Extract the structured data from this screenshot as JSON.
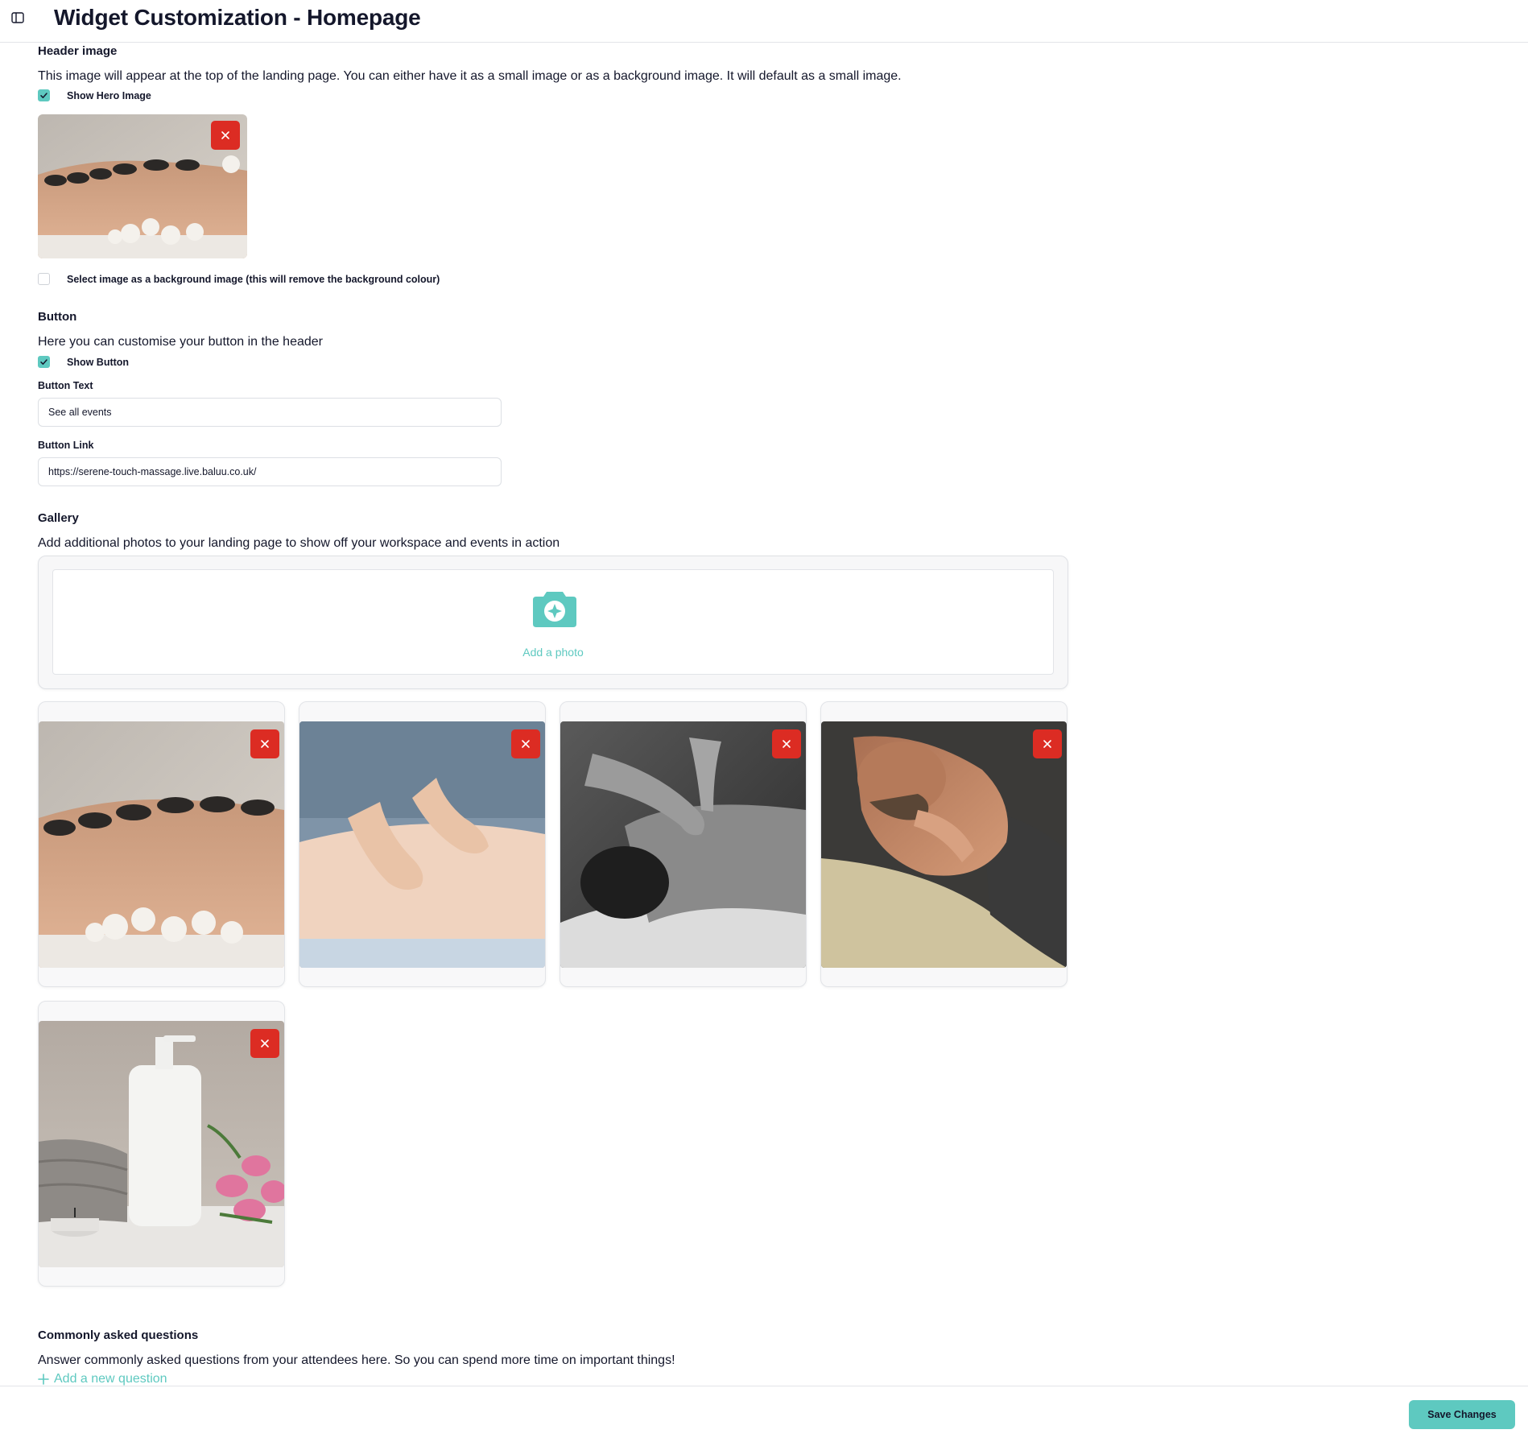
{
  "header": {
    "title": "Widget Customization - Homepage"
  },
  "header_image": {
    "title": "Header image",
    "description": "This image will appear at the top of the landing page. You can either have it as a small image or as a background image. It will default as a small image.",
    "show_hero_label": "Show Hero Image",
    "show_hero_checked": true,
    "background_option_label": "Select image as a background image (this will remove the background colour)",
    "background_option_checked": false
  },
  "button_section": {
    "title": "Button",
    "description": "Here you can customise your button in the header",
    "show_button_label": "Show Button",
    "show_button_checked": true,
    "text_label": "Button Text",
    "text_value": "See all events",
    "link_label": "Button Link",
    "link_value": "https://serene-touch-massage.live.baluu.co.uk/"
  },
  "gallery": {
    "title": "Gallery",
    "description": "Add additional photos to your landing page to show off your workspace and events in action",
    "add_photo_label": "Add a photo",
    "photos": [
      "hot-stones-massage",
      "back-massage-hands",
      "black-white-massage",
      "man-neck-massage",
      "spa-bottle-towel-tulips"
    ]
  },
  "faq": {
    "title": "Commonly asked questions",
    "description": "Answer commonly asked questions from your attendees here. So you can spend more time on important things!",
    "add_label": "Add a new question"
  },
  "footer": {
    "save_label": "Save Changes"
  },
  "colors": {
    "accent": "#5ec9c0",
    "danger": "#dc2c23",
    "text": "#14172b"
  }
}
